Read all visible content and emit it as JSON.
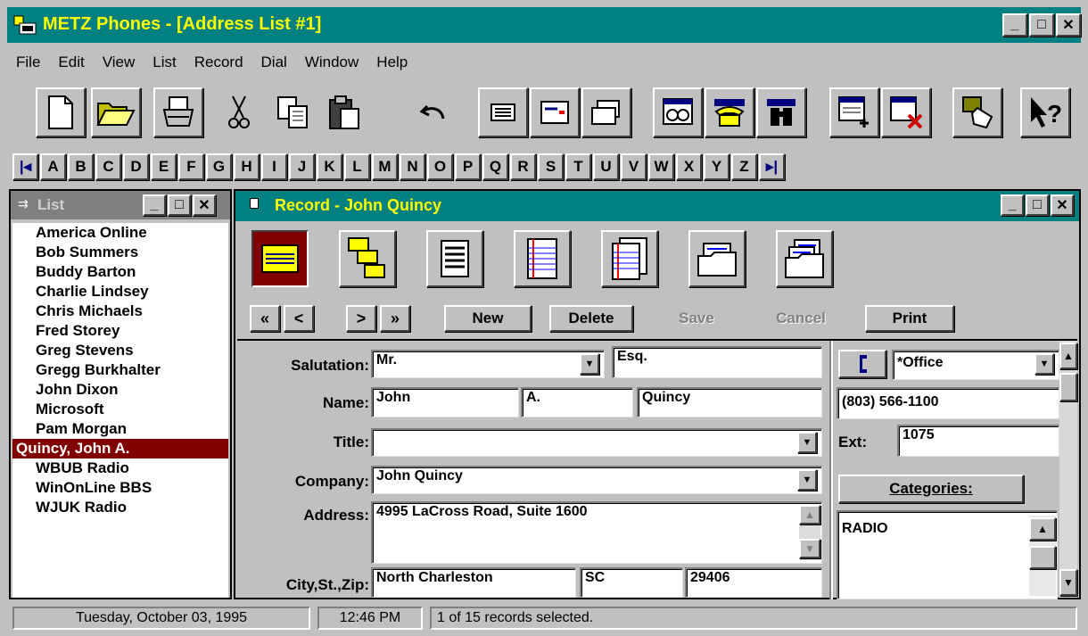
{
  "app": {
    "title": "METZ Phones - [Address List #1]"
  },
  "menu": [
    "File",
    "Edit",
    "View",
    "List",
    "Record",
    "Dial",
    "Window",
    "Help"
  ],
  "toolbar": {
    "icons": [
      "new-document-icon",
      "open-folder-icon",
      "print-icon",
      "cut-icon",
      "copy-icon",
      "paste-icon",
      "undo-icon",
      "list-view-icon",
      "card-view-icon",
      "envelope-view-icon",
      "view-records-icon",
      "dial-phone-icon",
      "find-binoculars-icon",
      "add-record-icon",
      "delete-record-icon",
      "dial-hand-icon",
      "context-help-icon"
    ]
  },
  "alphabet": [
    "A",
    "B",
    "C",
    "D",
    "E",
    "F",
    "G",
    "H",
    "I",
    "J",
    "K",
    "L",
    "M",
    "N",
    "O",
    "P",
    "Q",
    "R",
    "S",
    "T",
    "U",
    "V",
    "W",
    "X",
    "Y",
    "Z"
  ],
  "list_window": {
    "title": "List",
    "items": [
      "America Online",
      "Bob Summers",
      "Buddy Barton",
      "Charlie Lindsey",
      "Chris Michaels",
      "Fred Storey",
      "Greg Stevens",
      "Gregg Burkhalter",
      "John Dixon",
      "Microsoft",
      "Pam Morgan",
      "Quincy, John A.",
      "WBUB Radio",
      "WinOnLine BBS",
      "WJUK Radio"
    ],
    "selected_index": 11
  },
  "record_window": {
    "title": "Record - John Quincy",
    "nav": {
      "first": "«",
      "prev": "<",
      "next": ">",
      "last": "»"
    },
    "buttons": {
      "new": "New",
      "delete": "Delete",
      "save": "Save",
      "cancel": "Cancel",
      "print": "Print"
    },
    "labels": {
      "salutation": "Salutation:",
      "name": "Name:",
      "title": "Title:",
      "company": "Company:",
      "address": "Address:",
      "city_st_zip": "City,St.,Zip:",
      "ext": "Ext:",
      "categories": "Categories:"
    },
    "fields": {
      "salutation": "Mr.",
      "suffix": "Esq.",
      "first_name": "John",
      "middle": "A.",
      "last_name": "Quincy",
      "title": "",
      "company": "John Quincy",
      "address": "4995 LaCross Road, Suite 1600",
      "city": "North Charleston",
      "state": "SC",
      "zip": "29406",
      "phone_type": "*Office",
      "phone": "(803) 566-1100",
      "ext": "1075",
      "categories": "RADIO"
    }
  },
  "status": {
    "date": "Tuesday, October 03, 1995",
    "time": "12:46 PM",
    "message": "1 of 15 records selected."
  },
  "colors": {
    "title_bg": "#008080",
    "title_text": "#ffff00",
    "selection": "#800000"
  }
}
